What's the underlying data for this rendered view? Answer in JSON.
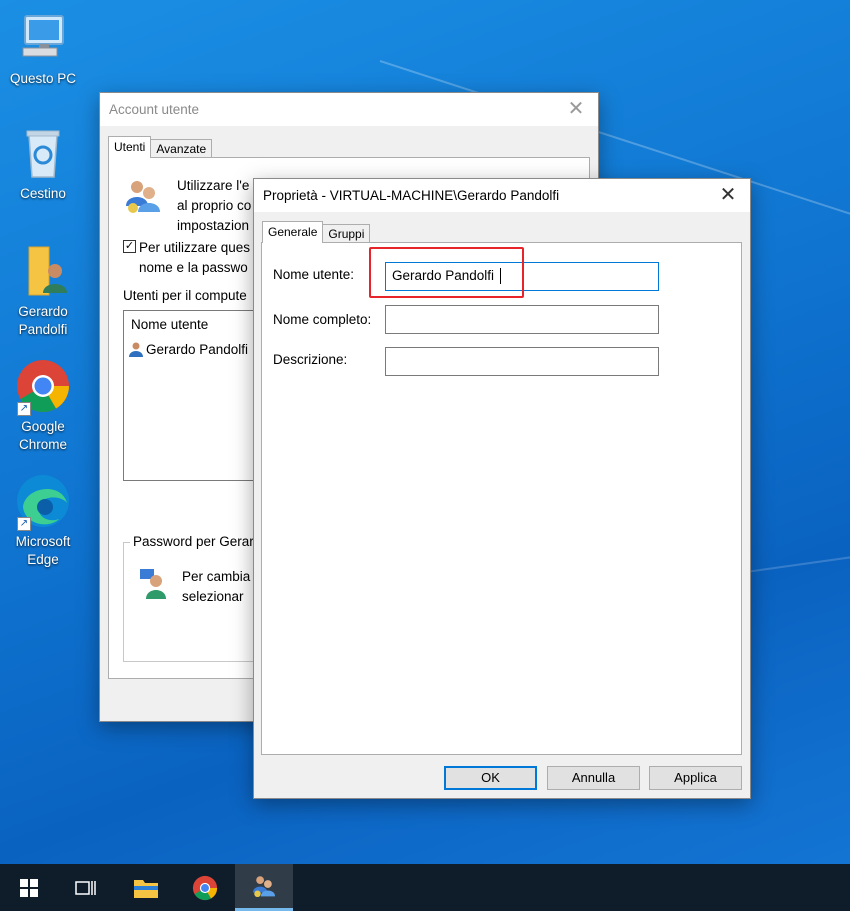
{
  "desktop": {
    "icons": [
      {
        "label": "Questo PC",
        "icon": "computer-icon"
      },
      {
        "label": "Cestino",
        "icon": "recycle-bin-icon"
      },
      {
        "label": "Gerardo Pandolfi",
        "icon": "user-folder-icon"
      },
      {
        "label": "Google Chrome",
        "icon": "chrome-icon"
      },
      {
        "label": "Microsoft Edge",
        "icon": "edge-icon"
      }
    ]
  },
  "account_window": {
    "title": "Account utente",
    "close": "✕",
    "tabs": [
      "Utenti",
      "Avanzate"
    ],
    "intro_text_lines": [
      "Utilizzare l'e",
      "al proprio co",
      "impostazion"
    ],
    "checkbox_label_lines": [
      "Per utilizzare ques",
      "nome e la passwo"
    ],
    "checkbox_checked": true,
    "users_label": "Utenti per il compute",
    "list_header": "Nome utente",
    "list_rows": [
      "Gerardo Pandolfi"
    ],
    "password_group_label": "Password per Gerar",
    "password_text_lines": [
      "Per cambia",
      "selezionar"
    ]
  },
  "properties_dialog": {
    "title": "Proprietà - VIRTUAL-MACHINE\\Gerardo Pandolfi",
    "close": "✕",
    "tabs": [
      "Generale",
      "Gruppi"
    ],
    "fields": {
      "username_label": "Nome utente:",
      "username_value": "Gerardo Pandolfi",
      "fullname_label": "Nome completo:",
      "fullname_value": "",
      "description_label": "Descrizione:",
      "description_value": ""
    },
    "buttons": {
      "ok": "OK",
      "cancel": "Annulla",
      "apply": "Applica"
    }
  },
  "taskbar": {
    "items": [
      "start-icon",
      "task-view-icon",
      "file-explorer-icon",
      "chrome-icon",
      "user-accounts-icon"
    ],
    "active": "user-accounts-icon"
  },
  "colors": {
    "desktop": "#0f74d0",
    "highlight": "#e8242b",
    "focus": "#0078d7",
    "taskbar": "#0f1d2b"
  }
}
